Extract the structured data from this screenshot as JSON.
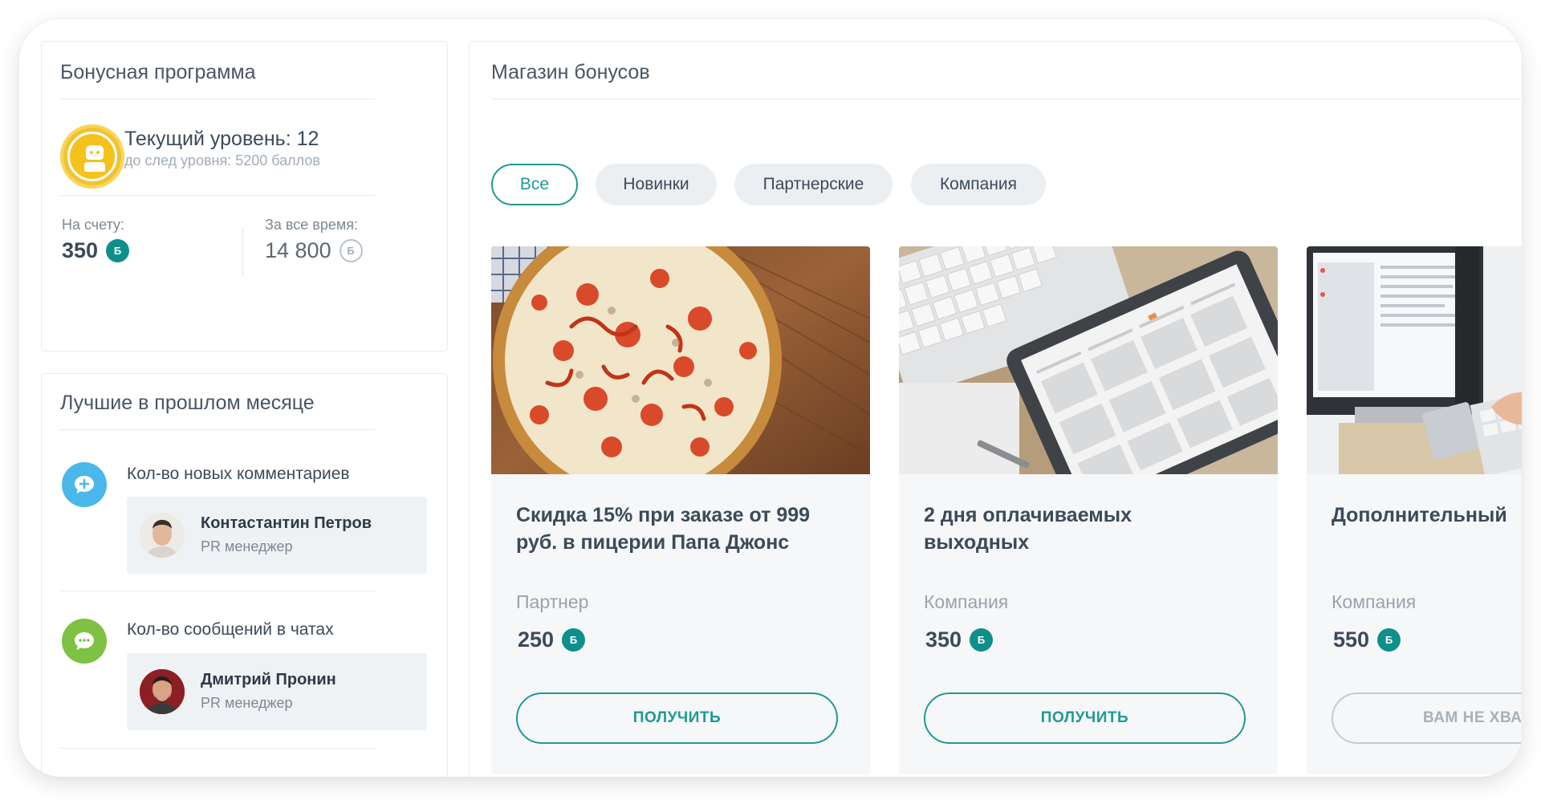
{
  "bonus_program": {
    "title": "Бонусная программа",
    "level_title": "Текущий уровень: 12",
    "level_subtitle": "до след уровня: 5200 баллов",
    "balance_label": "На счету:",
    "balance_value": "350",
    "total_label": "За все время:",
    "total_value": "14 800",
    "coin_symbol": "Б",
    "level_badge_icon": "robot-icon",
    "badge_color": "#f5c21b"
  },
  "leaders": {
    "title": "Лучшие в прошлом месяце",
    "categories": [
      {
        "label": "Кол-во новых комментариев",
        "icon": "comment-plus-icon",
        "icon_color": "#4ab8ea",
        "person": {
          "name": "Контастантин Петров",
          "role": "PR менеджер"
        }
      },
      {
        "label": "Кол-во сообщений в чатах",
        "icon": "chat-icon",
        "icon_color": "#7dc242",
        "person": {
          "name": "Дмитрий Пронин",
          "role": "PR менеджер"
        }
      }
    ]
  },
  "store": {
    "title": "Магазин бонусов",
    "tabs": [
      {
        "label": "Все",
        "active": true
      },
      {
        "label": "Новинки",
        "active": false
      },
      {
        "label": "Партнерские",
        "active": false
      },
      {
        "label": "Компания",
        "active": false
      }
    ],
    "cards": [
      {
        "title": "Скидка 15% при заказе от 999\nруб. в пицерии Папа Джонс",
        "category": "Партнер",
        "price": "250",
        "button": "ПОЛУЧИТЬ",
        "available": true,
        "image": "pizza-image"
      },
      {
        "title": "2 дня оплачиваемых\nвыходных",
        "category": "Компания",
        "price": "350",
        "button": "ПОЛУЧИТЬ",
        "available": true,
        "image": "tablet-calendar-image"
      },
      {
        "title": "Дополнительный",
        "category": "Компания",
        "price": "550",
        "button": "ВАМ НЕ ХВАТАЕТ",
        "available": false,
        "image": "computer-desk-image"
      }
    ]
  },
  "colors": {
    "accent": "#1e9a94",
    "coin": "#0f8f8a",
    "text": "#3c4a59",
    "muted": "#9aa3ad"
  }
}
